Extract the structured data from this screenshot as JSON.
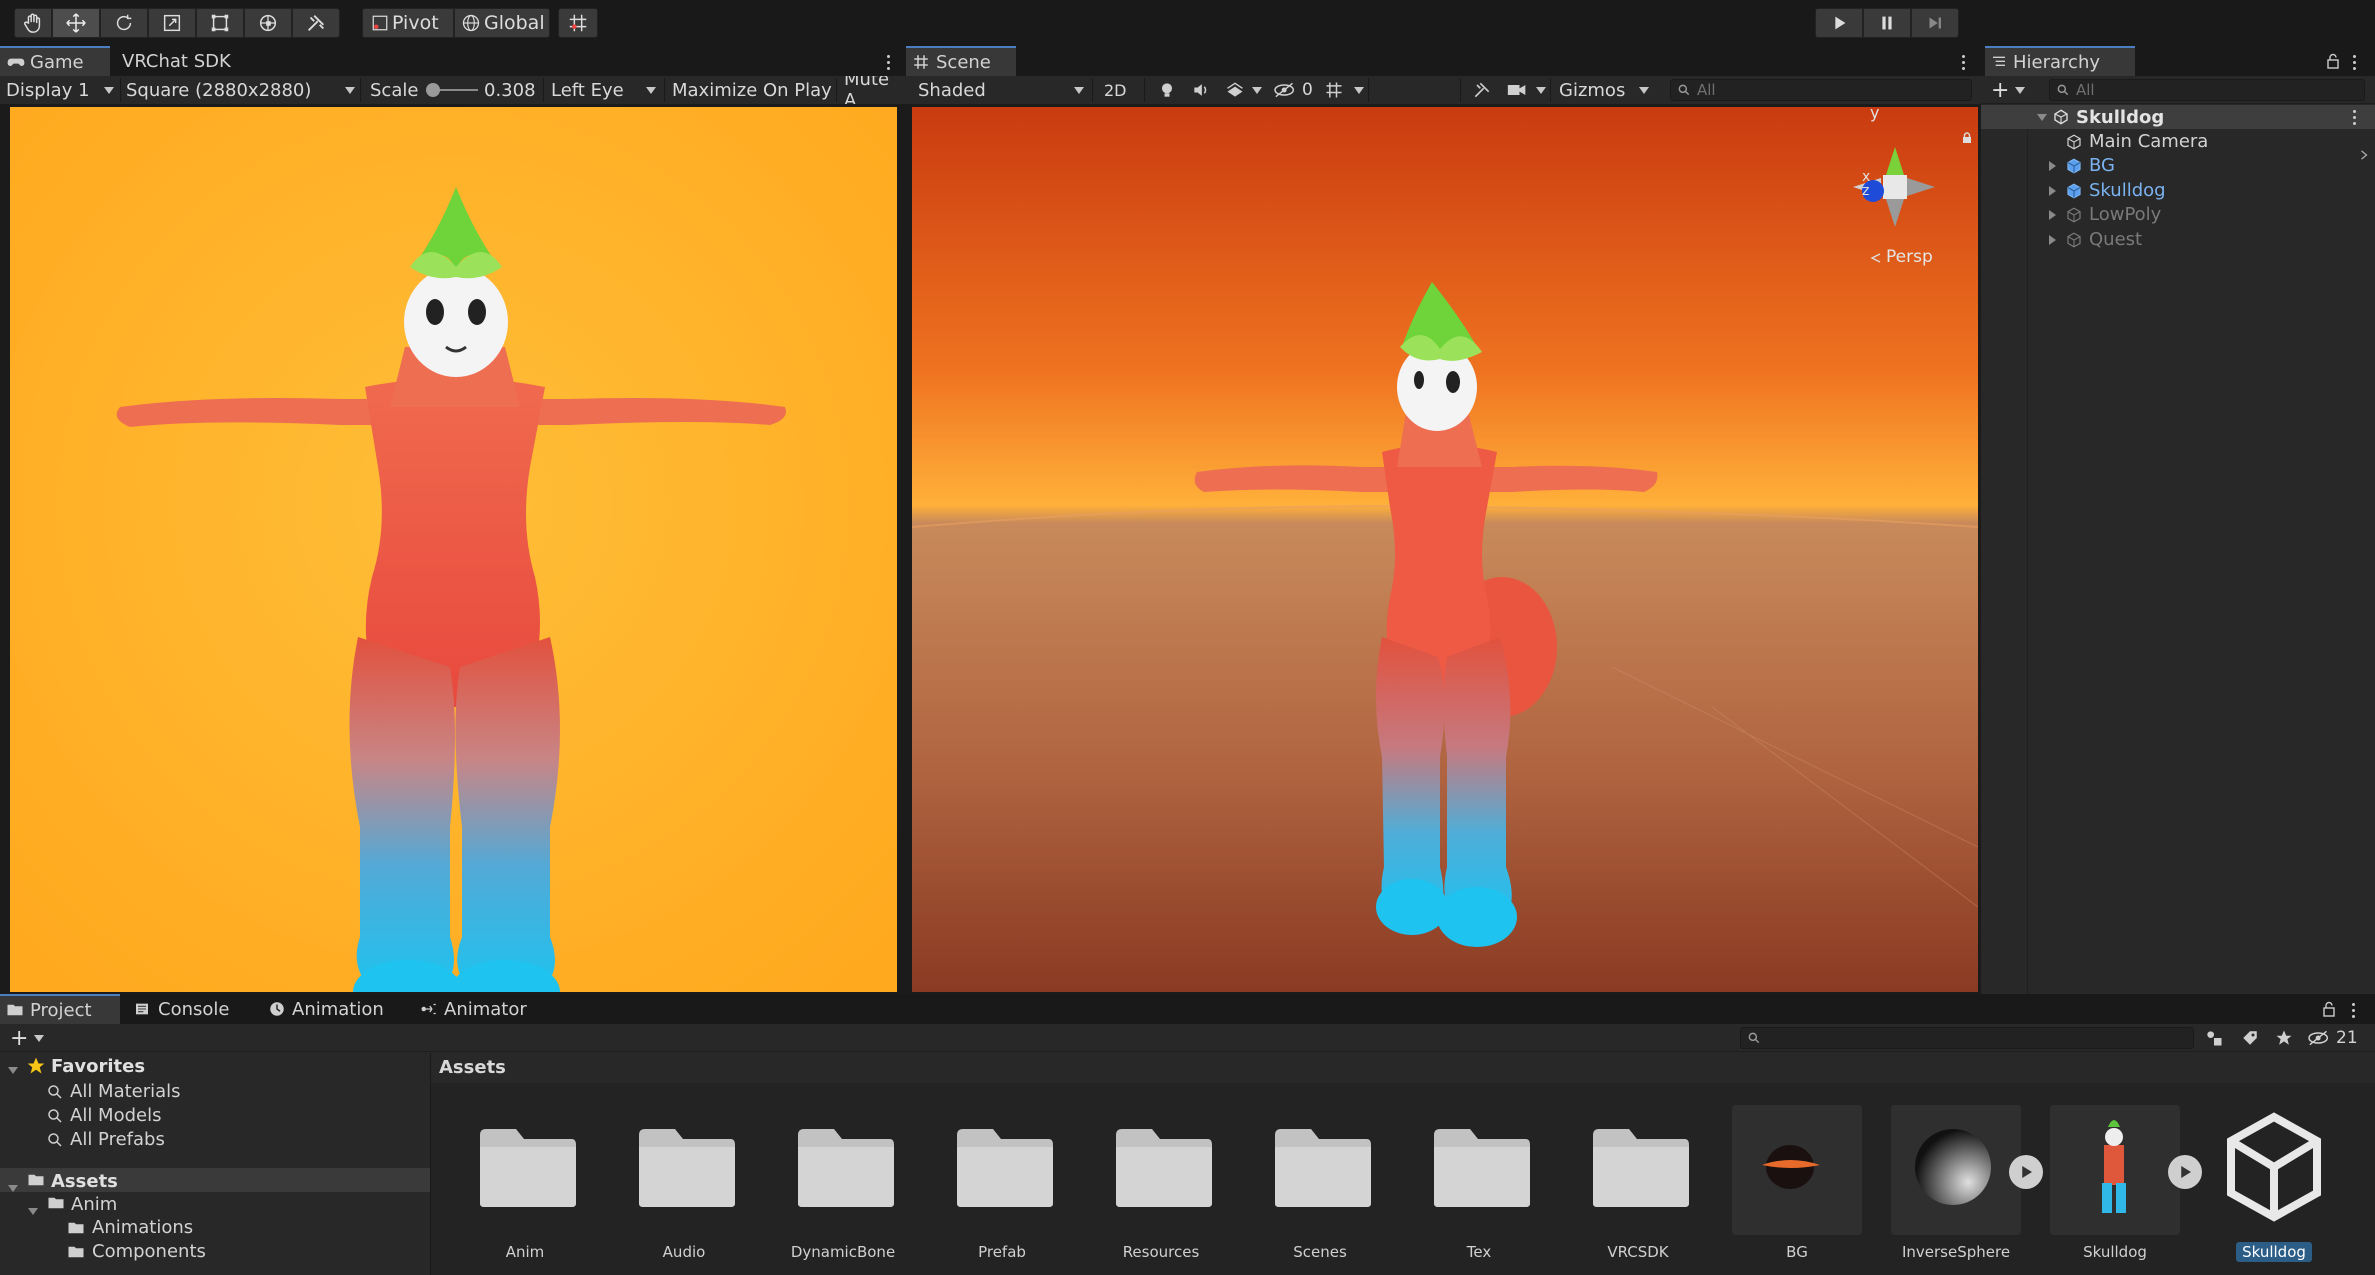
{
  "toolbar": {
    "pivot_label": "Pivot",
    "global_label": "Global",
    "tools": [
      "hand-icon",
      "move-icon",
      "rotate-icon",
      "scale-icon",
      "rect-icon",
      "transform-icon",
      "custom-tool-icon"
    ]
  },
  "game": {
    "tab_label": "Game",
    "second_tab_label": "VRChat SDK",
    "display_label": "Display 1",
    "resolution_label": "Square (2880x2880)",
    "scale_label": "Scale",
    "scale_value": "0.308",
    "scale_fraction": 0.1,
    "eye_label": "Left Eye",
    "maximize_label": "Maximize On Play",
    "mute_label": "Mute A",
    "bg_color": "#ffb427"
  },
  "scene": {
    "tab_label": "Scene",
    "shading_label": "Shaded",
    "mode_2d_label": "2D",
    "hidden_count": "0",
    "gizmos_label": "Gizmos",
    "search_placeholder": "All",
    "persp_label": "Persp",
    "axis_y": "y",
    "axis_x": "x",
    "axis_z": "z"
  },
  "hierarchy": {
    "tab_label": "Hierarchy",
    "search_placeholder": "All",
    "scene_name": "Skulldog",
    "items": [
      {
        "label": "Main Camera",
        "color": "#d2d2d2",
        "expandable": false
      },
      {
        "label": "BG",
        "color": "#7bb2f0",
        "expandable": true
      },
      {
        "label": "Skulldog",
        "color": "#7bb2f0",
        "expandable": true
      },
      {
        "label": "LowPoly",
        "color": "#7a7a7a",
        "expandable": true
      },
      {
        "label": "Quest",
        "color": "#7a7a7a",
        "expandable": true
      }
    ]
  },
  "project": {
    "tabs": [
      "Project",
      "Console",
      "Animation",
      "Animator"
    ],
    "hidden_count": "21",
    "breadcrumb": "Assets",
    "favorites_label": "Favorites",
    "favorites": [
      "All Materials",
      "All Models",
      "All Prefabs"
    ],
    "assets_root_label": "Assets",
    "anim_label": "Anim",
    "anim_children": [
      "Animations",
      "Components"
    ],
    "assets": [
      {
        "label": "Anim",
        "kind": "folder"
      },
      {
        "label": "Audio",
        "kind": "folder"
      },
      {
        "label": "DynamicBone",
        "kind": "folder"
      },
      {
        "label": "Prefab",
        "kind": "folder"
      },
      {
        "label": "Resources",
        "kind": "folder"
      },
      {
        "label": "Scenes",
        "kind": "folder"
      },
      {
        "label": "Tex",
        "kind": "folder"
      },
      {
        "label": "VRCSDK",
        "kind": "folder"
      },
      {
        "label": "BG",
        "kind": "thumb"
      },
      {
        "label": "InverseSphere",
        "kind": "thumb"
      },
      {
        "label": "Skulldog",
        "kind": "thumb"
      },
      {
        "label": "Skulldog",
        "kind": "unity"
      }
    ]
  }
}
